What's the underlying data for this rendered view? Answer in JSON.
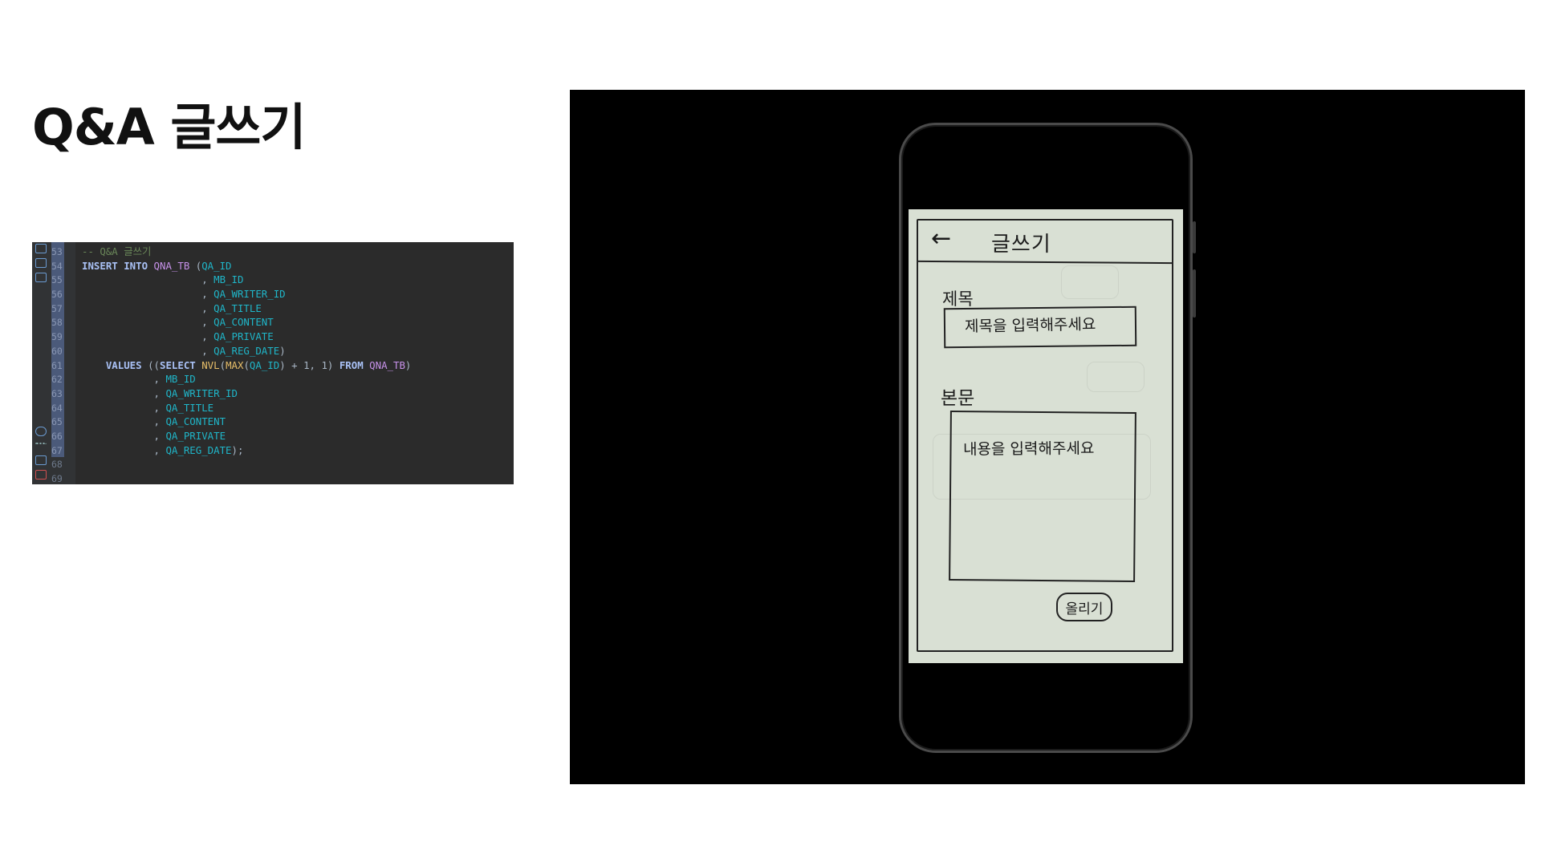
{
  "slide": {
    "title": "Q&A 글쓰기"
  },
  "code_editor": {
    "lines": [
      {
        "num": "53",
        "selected": true,
        "tokens": [
          {
            "t": "-- Q&A 글쓰기",
            "c": "cmt"
          }
        ]
      },
      {
        "num": "54",
        "selected": true,
        "tokens": [
          {
            "t": "INSERT INTO ",
            "c": "kw"
          },
          {
            "t": "QNA_TB",
            "c": "tbl"
          },
          {
            "t": " (",
            "c": "p"
          },
          {
            "t": "QA_ID",
            "c": "col"
          }
        ]
      },
      {
        "num": "55",
        "selected": true,
        "tokens": [
          {
            "t": "                    , ",
            "c": "p"
          },
          {
            "t": "MB_ID",
            "c": "col"
          }
        ]
      },
      {
        "num": "56",
        "selected": true,
        "tokens": [
          {
            "t": "                    , ",
            "c": "p"
          },
          {
            "t": "QA_WRITER_ID",
            "c": "col"
          }
        ]
      },
      {
        "num": "57",
        "selected": true,
        "tokens": [
          {
            "t": "                    , ",
            "c": "p"
          },
          {
            "t": "QA_TITLE",
            "c": "col"
          }
        ]
      },
      {
        "num": "58",
        "selected": true,
        "tokens": [
          {
            "t": "                    , ",
            "c": "p"
          },
          {
            "t": "QA_CONTENT",
            "c": "col"
          }
        ]
      },
      {
        "num": "59",
        "selected": true,
        "tokens": [
          {
            "t": "                    , ",
            "c": "p"
          },
          {
            "t": "QA_PRIVATE",
            "c": "col"
          }
        ]
      },
      {
        "num": "60",
        "selected": true,
        "tokens": [
          {
            "t": "                    , ",
            "c": "p"
          },
          {
            "t": "QA_REG_DATE",
            "c": "col"
          },
          {
            "t": ")",
            "c": "p"
          }
        ]
      },
      {
        "num": "61",
        "selected": true,
        "tokens": [
          {
            "t": "    VALUES ",
            "c": "kw"
          },
          {
            "t": "((",
            "c": "p"
          },
          {
            "t": "SELECT ",
            "c": "kw"
          },
          {
            "t": "NVL",
            "c": "fn"
          },
          {
            "t": "(",
            "c": "p"
          },
          {
            "t": "MAX",
            "c": "fn"
          },
          {
            "t": "(",
            "c": "p"
          },
          {
            "t": "QA_ID",
            "c": "col"
          },
          {
            "t": ") + 1, 1) ",
            "c": "p"
          },
          {
            "t": "FROM ",
            "c": "kw"
          },
          {
            "t": "QNA_TB",
            "c": "tbl"
          },
          {
            "t": ")",
            "c": "p"
          }
        ]
      },
      {
        "num": "62",
        "selected": true,
        "tokens": [
          {
            "t": "            , ",
            "c": "p"
          },
          {
            "t": "MB_ID",
            "c": "col"
          }
        ]
      },
      {
        "num": "63",
        "selected": true,
        "tokens": [
          {
            "t": "            , ",
            "c": "p"
          },
          {
            "t": "QA_WRITER_ID",
            "c": "col"
          }
        ]
      },
      {
        "num": "64",
        "selected": true,
        "tokens": [
          {
            "t": "            , ",
            "c": "p"
          },
          {
            "t": "QA_TITLE",
            "c": "col"
          }
        ]
      },
      {
        "num": "65",
        "selected": true,
        "tokens": [
          {
            "t": "            , ",
            "c": "p"
          },
          {
            "t": "QA_CONTENT",
            "c": "col"
          }
        ]
      },
      {
        "num": "66",
        "selected": true,
        "tokens": [
          {
            "t": "            , ",
            "c": "p"
          },
          {
            "t": "QA_PRIVATE",
            "c": "col"
          }
        ]
      },
      {
        "num": "67",
        "selected": true,
        "tokens": [
          {
            "t": "            , ",
            "c": "p"
          },
          {
            "t": "QA_REG_DATE",
            "c": "col"
          },
          {
            "t": ");",
            "c": "p"
          }
        ]
      },
      {
        "num": "68",
        "selected": false,
        "tokens": []
      },
      {
        "num": "69",
        "selected": false,
        "tokens": []
      }
    ],
    "toolstrip_icons": [
      "file-icon",
      "database-icon",
      "folder-icon",
      "settings-icon",
      "more-icon",
      "document-icon",
      "document-error-icon"
    ]
  },
  "mockup": {
    "header_title": "글쓰기",
    "back_arrow": "←",
    "title_label": "제목",
    "title_placeholder": "제목을 입력해주세요",
    "body_label": "본문",
    "body_placeholder": "내용을 입력해주세요",
    "submit_label": "올리기"
  },
  "colors": {
    "editor_bg": "#2b2b2b",
    "keyword": "#a9c1f5",
    "column": "#1fb6c9",
    "table": "#c792ea",
    "function": "#e8bf6a",
    "comment": "#6a8759",
    "stage_bg": "#000000",
    "paper": "#d9e0d4"
  }
}
